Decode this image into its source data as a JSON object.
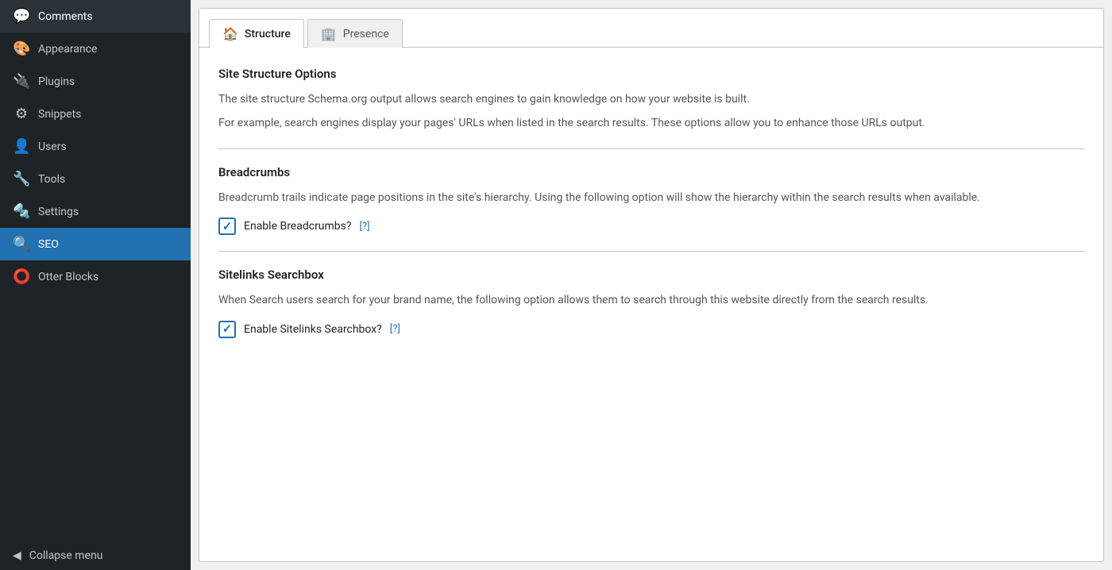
{
  "sidebar": {
    "items": [
      {
        "id": "comments",
        "label": "Comments",
        "icon": "💬",
        "active": false
      },
      {
        "id": "appearance",
        "label": "Appearance",
        "icon": "🎨",
        "active": false
      },
      {
        "id": "plugins",
        "label": "Plugins",
        "icon": "🔌",
        "active": false
      },
      {
        "id": "snippets",
        "label": "Snippets",
        "icon": "⚙",
        "active": false
      },
      {
        "id": "users",
        "label": "Users",
        "icon": "👤",
        "active": false
      },
      {
        "id": "tools",
        "label": "Tools",
        "icon": "🔧",
        "active": false
      },
      {
        "id": "settings",
        "label": "Settings",
        "icon": "🔩",
        "active": false
      },
      {
        "id": "seo",
        "label": "SEO",
        "icon": "🔍",
        "active": true
      },
      {
        "id": "otter-blocks",
        "label": "Otter Blocks",
        "icon": "⭕",
        "active": false
      }
    ],
    "collapse_label": "Collapse menu",
    "collapse_icon": "◀"
  },
  "tabs": [
    {
      "id": "structure",
      "label": "Structure",
      "icon": "🏠",
      "active": true
    },
    {
      "id": "presence",
      "label": "Presence",
      "icon": "🏢",
      "active": false
    }
  ],
  "content": {
    "site_structure": {
      "title": "Site Structure Options",
      "desc1": "The site structure Schema.org output allows search engines to gain knowledge on how your website is built.",
      "desc2": "For example, search engines display your pages' URLs when listed in the search results. These options allow you to enhance those URLs output."
    },
    "breadcrumbs": {
      "title": "Breadcrumbs",
      "desc": "Breadcrumb trails indicate page positions in the site's hierarchy. Using the following option will show the hierarchy within the search results when available.",
      "checkbox_label": "Enable Breadcrumbs?",
      "help_text": "[?]",
      "checked": true
    },
    "sitelinks": {
      "title": "Sitelinks Searchbox",
      "desc": "When Search users search for your brand name, the following option allows them to search through this website directly from the search results.",
      "checkbox_label": "Enable Sitelinks Searchbox?",
      "help_text": "[?]",
      "checked": true
    }
  }
}
